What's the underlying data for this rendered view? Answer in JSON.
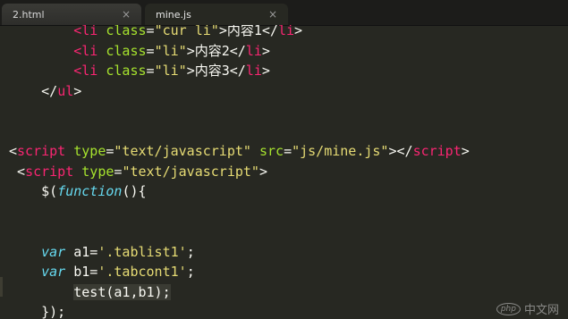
{
  "tabs": [
    {
      "label": "2.html",
      "close": "×"
    },
    {
      "label": "mine.js",
      "close": "×"
    }
  ],
  "code_lines": [
    {
      "indent": "        ",
      "segments": [
        {
          "t": "<li",
          "c": "tag"
        },
        {
          "t": " ",
          "c": "plain"
        },
        {
          "t": "class",
          "c": "attr"
        },
        {
          "t": "=",
          "c": "plain"
        },
        {
          "t": "\"cur li\"",
          "c": "str"
        },
        {
          "t": ">内容1</",
          "c": "plain"
        },
        {
          "t": "li",
          "c": "tag"
        },
        {
          "t": ">",
          "c": "plain"
        }
      ]
    },
    {
      "indent": "        ",
      "segments": [
        {
          "t": "<li",
          "c": "tag"
        },
        {
          "t": " ",
          "c": "plain"
        },
        {
          "t": "class",
          "c": "attr"
        },
        {
          "t": "=",
          "c": "plain"
        },
        {
          "t": "\"li\"",
          "c": "str"
        },
        {
          "t": ">内容2</",
          "c": "plain"
        },
        {
          "t": "li",
          "c": "tag"
        },
        {
          "t": ">",
          "c": "plain"
        }
      ]
    },
    {
      "indent": "        ",
      "segments": [
        {
          "t": "<li",
          "c": "tag"
        },
        {
          "t": " ",
          "c": "plain"
        },
        {
          "t": "class",
          "c": "attr"
        },
        {
          "t": "=",
          "c": "plain"
        },
        {
          "t": "\"li\"",
          "c": "str"
        },
        {
          "t": ">内容3</",
          "c": "plain"
        },
        {
          "t": "li",
          "c": "tag"
        },
        {
          "t": ">",
          "c": "plain"
        }
      ]
    },
    {
      "indent": "    ",
      "segments": [
        {
          "t": "</",
          "c": "plain"
        },
        {
          "t": "ul",
          "c": "tag"
        },
        {
          "t": ">",
          "c": "plain"
        }
      ]
    },
    {
      "indent": "",
      "segments": []
    },
    {
      "indent": "",
      "segments": []
    },
    {
      "indent": "",
      "segments": [
        {
          "t": "<",
          "c": "plain"
        },
        {
          "t": "script",
          "c": "tag"
        },
        {
          "t": " ",
          "c": "plain"
        },
        {
          "t": "type",
          "c": "attr"
        },
        {
          "t": "=",
          "c": "plain"
        },
        {
          "t": "\"text/javascript\"",
          "c": "str"
        },
        {
          "t": " ",
          "c": "plain"
        },
        {
          "t": "src",
          "c": "attr"
        },
        {
          "t": "=",
          "c": "plain"
        },
        {
          "t": "\"js/mine.js\"",
          "c": "str"
        },
        {
          "t": "></",
          "c": "plain"
        },
        {
          "t": "script",
          "c": "tag"
        },
        {
          "t": ">",
          "c": "plain"
        }
      ]
    },
    {
      "indent": " ",
      "segments": [
        {
          "t": "<",
          "c": "plain"
        },
        {
          "t": "script",
          "c": "tag"
        },
        {
          "t": " ",
          "c": "plain"
        },
        {
          "t": "type",
          "c": "attr"
        },
        {
          "t": "=",
          "c": "plain"
        },
        {
          "t": "\"text/javascript\"",
          "c": "str"
        },
        {
          "t": ">",
          "c": "plain"
        }
      ]
    },
    {
      "indent": "    ",
      "segments": [
        {
          "t": "$(",
          "c": "plain"
        },
        {
          "t": "function",
          "c": "kw"
        },
        {
          "t": "(){",
          "c": "plain"
        }
      ]
    },
    {
      "indent": "",
      "segments": []
    },
    {
      "indent": "",
      "segments": []
    },
    {
      "indent": "    ",
      "segments": [
        {
          "t": "var",
          "c": "kw"
        },
        {
          "t": " a1=",
          "c": "plain"
        },
        {
          "t": "'.tablist1'",
          "c": "str"
        },
        {
          "t": ";",
          "c": "plain"
        }
      ]
    },
    {
      "indent": "    ",
      "segments": [
        {
          "t": "var",
          "c": "kw"
        },
        {
          "t": " b1=",
          "c": "plain"
        },
        {
          "t": "'.tabcont1'",
          "c": "str"
        },
        {
          "t": ";",
          "c": "plain"
        }
      ]
    },
    {
      "indent": "        ",
      "highlight": true,
      "segments": [
        {
          "t": "test(a1,b1);",
          "c": "plain"
        }
      ]
    },
    {
      "indent": "    ",
      "segments": [
        {
          "t": "});",
          "c": "plain"
        }
      ]
    }
  ],
  "watermark": {
    "logo": "php",
    "text": "中文网"
  }
}
